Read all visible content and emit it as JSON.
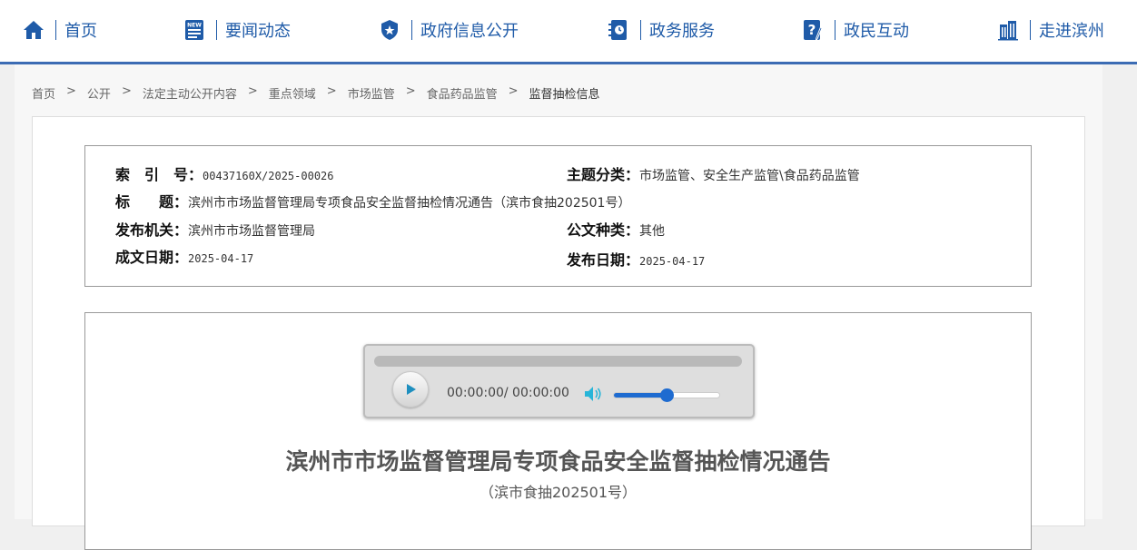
{
  "nav": {
    "items": [
      {
        "icon": "home-icon",
        "label": "首页"
      },
      {
        "icon": "news-icon",
        "label": "要闻动态"
      },
      {
        "icon": "badge-icon",
        "label": "政府信息公开"
      },
      {
        "icon": "service-icon",
        "label": "政务服务"
      },
      {
        "icon": "qa-icon",
        "label": "政民互动"
      },
      {
        "icon": "building-icon",
        "label": "走进滨州"
      }
    ],
    "accent": "#1f5ba8",
    "bar_color": "#3c6cb4"
  },
  "breadcrumb": {
    "items": [
      "首页",
      "公开",
      "法定主动公开内容",
      "重点领域",
      "市场监管",
      "食品药品监管",
      "监督抽检信息"
    ],
    "separator": ">"
  },
  "meta": {
    "index_label": "索　引　号：",
    "index_value": "00437160X/2025-00026",
    "topic_label": "主题分类：",
    "topic_value": "市场监管、安全生产监管\\食品药品监管",
    "title_label": "标　　题：",
    "title_value": "滨州市市场监督管理局专项食品安全监督抽检情况通告（滨市食抽202501号）",
    "issuer_label": "发布机关：",
    "issuer_value": "滨州市市场监督管理局",
    "doctype_label": "公文种类：",
    "doctype_value": "其他",
    "written_label": "成文日期：",
    "written_value": "2025-04-17",
    "published_label": "发布日期：",
    "published_value": "2025-04-17"
  },
  "player": {
    "time": "00:00:00/ 00:00:00",
    "progress": 0,
    "volume": 0.5
  },
  "article": {
    "title": "滨州市市场监督管理局专项食品安全监督抽检情况通告",
    "subtitle": "（滨市食抽202501号）"
  }
}
